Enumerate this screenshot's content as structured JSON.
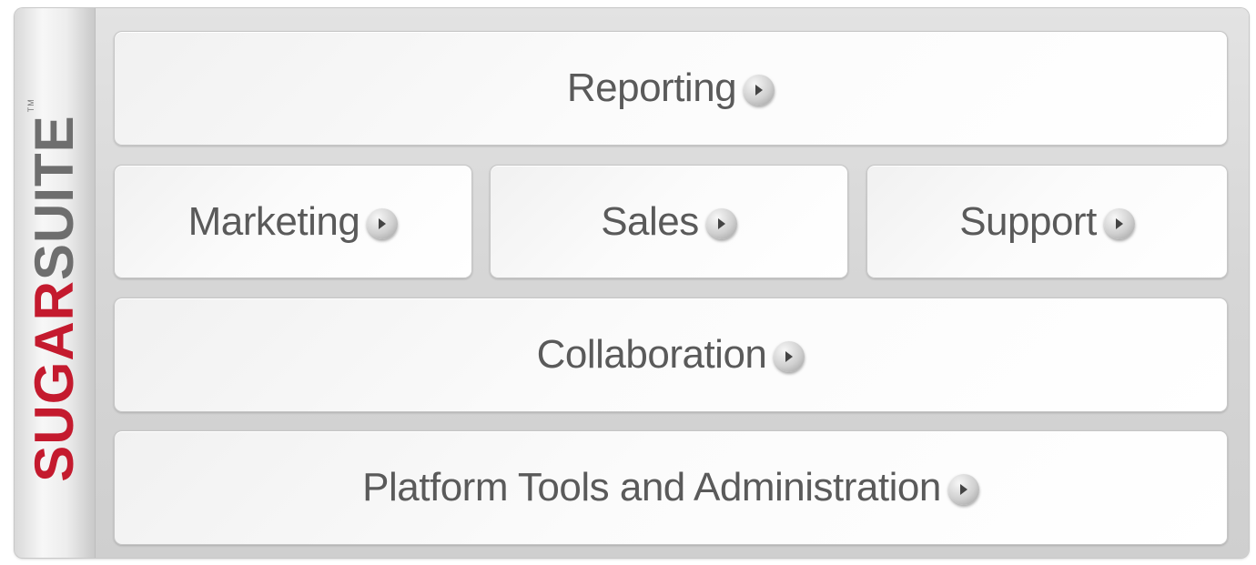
{
  "brand": {
    "sugar": "SUGAR",
    "suite": "SUITE",
    "tm": "TM"
  },
  "tiles": {
    "reporting": "Reporting",
    "marketing": "Marketing",
    "sales": "Sales",
    "support": "Support",
    "collaboration": "Collaboration",
    "platform": "Platform Tools and Administration"
  },
  "colors": {
    "brand_red": "#c41a2e",
    "brand_gray": "#6e6e6e",
    "label_gray": "#5a5a5a"
  },
  "icons": {
    "tile_arrow": "circle-arrow-right-icon"
  }
}
